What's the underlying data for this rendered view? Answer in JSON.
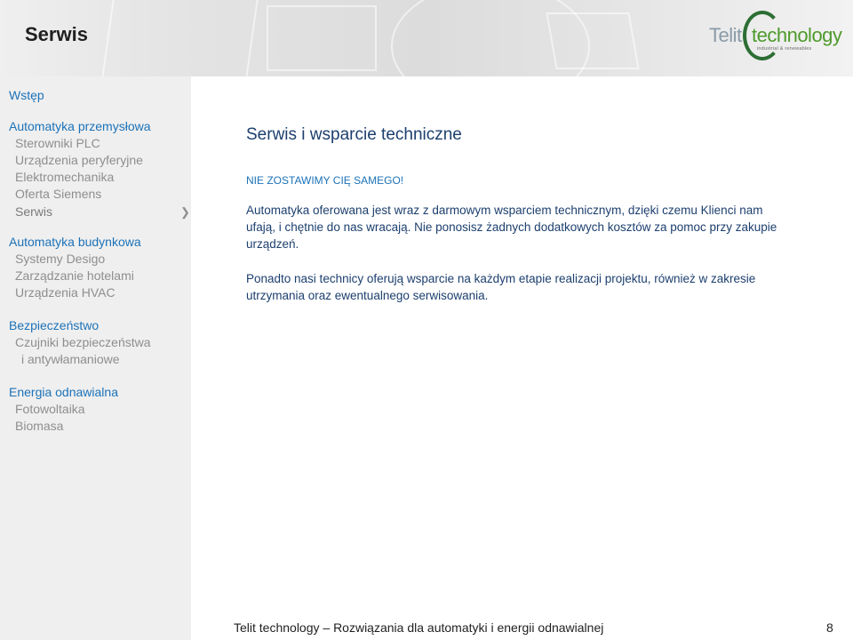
{
  "header": {
    "title": "Serwis",
    "logo": {
      "name": "Telit",
      "accent": "technology",
      "tagline": "industrial & renewables"
    }
  },
  "sidebar": {
    "groups": [
      {
        "title": "Wstęp",
        "items": []
      },
      {
        "title": "Automatyka przemysłowa",
        "items": [
          "Sterowniki PLC",
          "Urządzenia peryferyjne",
          "Elektromechanika",
          "Oferta Siemens",
          "Serwis"
        ]
      },
      {
        "title": "Automatyka budynkowa",
        "items": [
          "Systemy Desigo",
          "Zarządzanie hotelami",
          "Urządzenia HVAC"
        ]
      },
      {
        "title": "Bezpieczeństwo",
        "items": [
          "Czujniki bezpieczeństwa",
          "i antywłamaniowe"
        ]
      },
      {
        "title": "Energia odnawialna",
        "items": [
          "Fotowoltaika",
          "Biomasa"
        ]
      }
    ],
    "active_item": "Serwis",
    "active_marker": "❯"
  },
  "main": {
    "title": "Serwis i wsparcie techniczne",
    "subheading": "NIE ZOSTAWIMY CIĘ SAMEGO!",
    "paragraphs": [
      "Automatyka oferowana jest wraz z darmowym wsparciem technicznym, dzięki czemu Klienci nam ufają, i chętnie do nas wracają. Nie ponosisz żadnych dodatkowych kosztów za pomoc przy zakupie urządzeń.",
      "Ponadto nasi technicy oferują wsparcie na każdym etapie realizacji projektu, również w zakresie utrzymania oraz ewentualnego serwisowania."
    ]
  },
  "footer": {
    "text": "Telit technology – Rozwiązania dla automatyki i energii odnawialnej",
    "page_number": "8"
  },
  "colors": {
    "link_blue": "#1c72b8",
    "orange_accent": "#e56f10",
    "text_dark_blue": "#1c3f6e",
    "sidebar_bg": "#efefef",
    "nav_gray": "#8e8e8e",
    "logo_green": "#4e9a2c"
  }
}
